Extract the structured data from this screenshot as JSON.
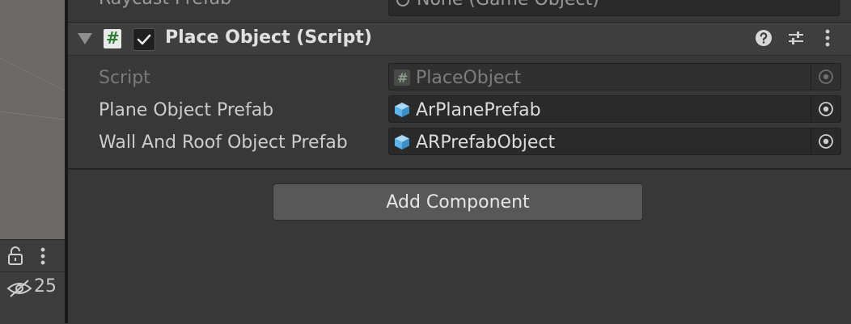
{
  "previous_property": {
    "label": "Raycast Prefab",
    "value": "None (Game Object)"
  },
  "component": {
    "title": "Place Object (Script)",
    "script_icon_glyph": "#",
    "enabled": true,
    "icons": {
      "foldout": "triangle-down-icon",
      "script": "csharp-script-icon",
      "toggle": "checkbox-checked-icon",
      "help": "help-circle-icon",
      "presets": "sliders-icon",
      "menu": "kebab-menu-icon"
    }
  },
  "properties": [
    {
      "label": "Script",
      "value": "PlaceObject",
      "type_icon": "script-hash-icon",
      "disabled": true
    },
    {
      "label": "Plane Object Prefab",
      "value": "ArPlanePrefab",
      "type_icon": "prefab-cube-icon",
      "disabled": false
    },
    {
      "label": "Wall And Roof Object Prefab",
      "value": "ARPrefabObject",
      "type_icon": "prefab-cube-icon",
      "disabled": false
    }
  ],
  "add_component_label": "Add Component",
  "left_panel": {
    "hidden_layers_count": "25",
    "icons": [
      "lock-open-icon",
      "kebab-menu-icon",
      "eye-slash-icon"
    ]
  },
  "colors": {
    "background": "#383838",
    "field": "#2a2a2a",
    "prefab_blue": "#5bb3e8",
    "button": "#585858"
  }
}
